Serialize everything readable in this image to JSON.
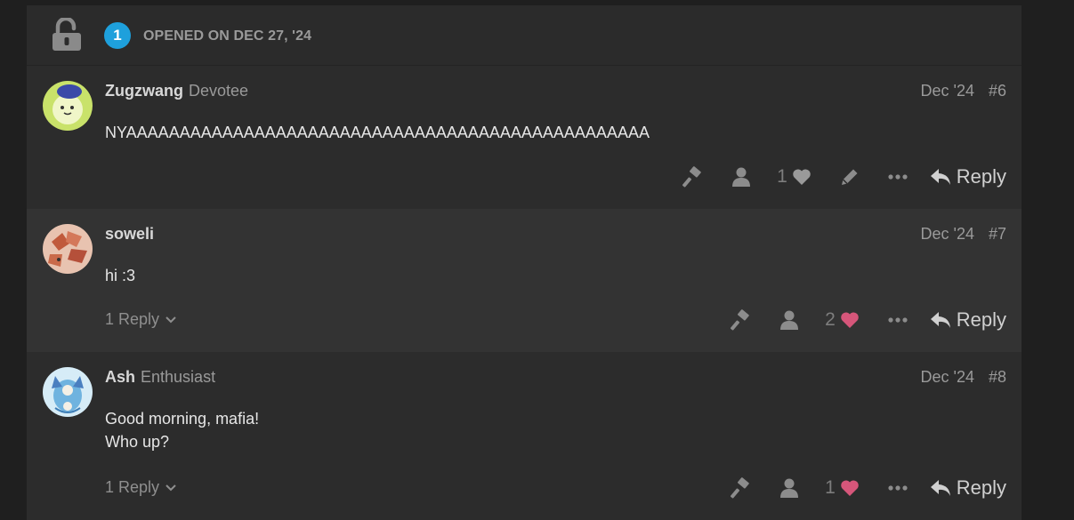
{
  "timeline": {
    "badge_number": "1",
    "action_text": "OPENED ON DEC 27, '24"
  },
  "posts": [
    {
      "username": "Zugzwang",
      "user_title": "Devotee",
      "date": "Dec '24",
      "post_number": "#6",
      "body_lines": [
        "NYAAAAAAAAAAAAAAAAAAAAAAAAAAAAAAAAAAAAAAAAAAAAAAAAA"
      ],
      "like_count": "1",
      "liked": false,
      "reply_label": "Reply",
      "replies_label": ""
    },
    {
      "username": "soweli",
      "user_title": "",
      "date": "Dec '24",
      "post_number": "#7",
      "body_lines": [
        "hi :3"
      ],
      "like_count": "2",
      "liked": true,
      "reply_label": "Reply",
      "replies_label": "1 Reply"
    },
    {
      "username": "Ash",
      "user_title": "Enthusiast",
      "date": "Dec '24",
      "post_number": "#8",
      "body_lines": [
        "Good morning, mafia!",
        "Who up?"
      ],
      "like_count": "1",
      "liked": true,
      "reply_label": "Reply",
      "replies_label": "1 Reply"
    }
  ],
  "colors": {
    "heart_liked": "#d6567a",
    "heart_default": "#9a9a9a",
    "badge": "#1ea0dc"
  }
}
